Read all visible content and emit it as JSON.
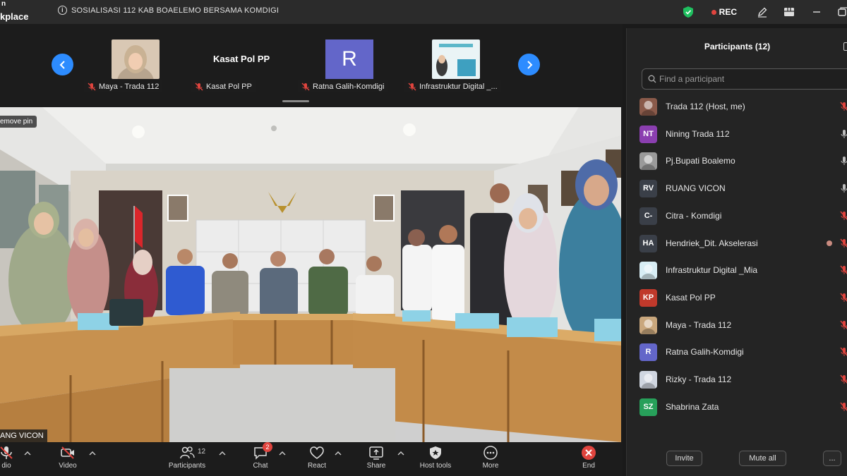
{
  "app": {
    "brand_line1": "n",
    "brand_line2": "kplace"
  },
  "meeting": {
    "title": "SOSIALISASI 112 KAB BOAELEMO BERSAMA KOMDIGI"
  },
  "titlebar": {
    "rec_label": "REC"
  },
  "strip": {
    "tiles": [
      {
        "name": "Maya - Trada 112",
        "type": "photo"
      },
      {
        "name": "Kasat Pol PP",
        "type": "text",
        "display": "Kasat Pol PP"
      },
      {
        "name": "Ratna Galih-Komdigi",
        "type": "avatar",
        "initial": "R"
      },
      {
        "name": "Infrastruktur Digital _...",
        "type": "photo"
      }
    ]
  },
  "main_video": {
    "remove_pin_label": "emove pin",
    "speaker_label": "ANG VICON"
  },
  "toolbar": {
    "audio_label": "dio",
    "video_label": "Video",
    "participants_label": "Participants",
    "participants_count": "12",
    "chat_label": "Chat",
    "chat_badge": "2",
    "react_label": "React",
    "share_label": "Share",
    "host_tools_label": "Host tools",
    "more_label": "More",
    "end_label": "End"
  },
  "panel": {
    "title": "Participants (12)",
    "search_placeholder": "Find a participant",
    "participants": [
      {
        "name": "Trada 112 (Host, me)",
        "initials": "",
        "color": "#8a5a4a",
        "mic": "off"
      },
      {
        "name": "Nining Trada 112",
        "initials": "NT",
        "color": "#8b3fb0",
        "mic": "on"
      },
      {
        "name": "Pj.Bupati Boalemo",
        "initials": "",
        "color": "#9a9a9a",
        "mic": "on"
      },
      {
        "name": "RUANG VICON",
        "initials": "RV",
        "color": "#3a3f48",
        "mic": "on"
      },
      {
        "name": "Citra - Komdigi",
        "initials": "C-",
        "color": "#3a3f48",
        "mic": "off"
      },
      {
        "name": "Hendriek_Dit. Akselerasi",
        "initials": "HA",
        "color": "#3a3f48",
        "mic": "off"
      },
      {
        "name": "Infrastruktur Digital _Mia",
        "initials": "",
        "color": "#d8eef5",
        "mic": "off"
      },
      {
        "name": "Kasat Pol PP",
        "initials": "KP",
        "color": "#c0392b",
        "mic": "off"
      },
      {
        "name": "Maya - Trada 112",
        "initials": "",
        "color": "#c9a77d",
        "mic": "off"
      },
      {
        "name": "Ratna Galih-Komdigi",
        "initials": "R",
        "color": "#6366c9",
        "mic": "off"
      },
      {
        "name": "Rizky - Trada 112",
        "initials": "",
        "color": "#d0d6e0",
        "mic": "off"
      },
      {
        "name": "Shabrina Zata",
        "initials": "SZ",
        "color": "#27a05a",
        "mic": "off"
      }
    ],
    "invite_label": "Invite",
    "mute_all_label": "Mute all",
    "more_label": "..."
  }
}
